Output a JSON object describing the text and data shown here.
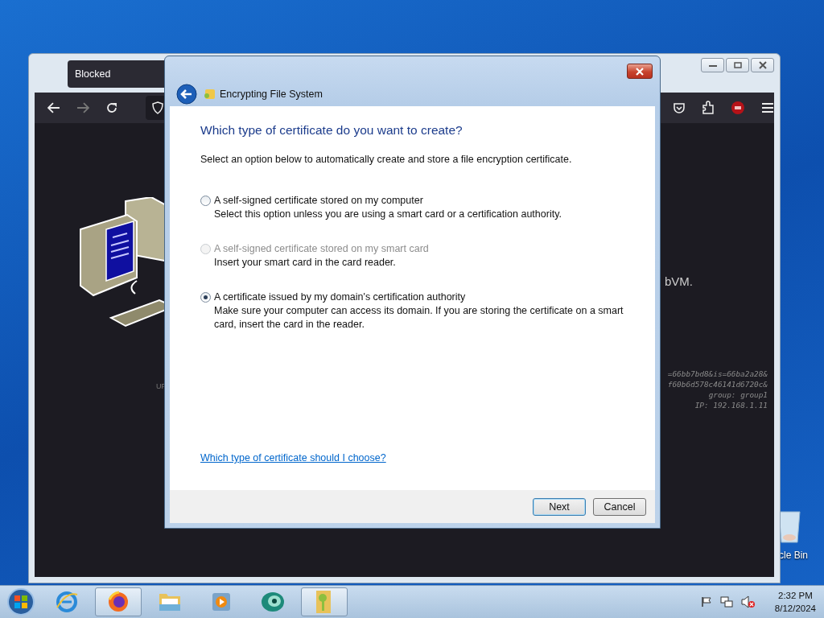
{
  "desktop": {
    "recycle_bin_label": "cle Bin"
  },
  "browser": {
    "tab": {
      "label": "Blocked",
      "selected": true
    },
    "page_fragment": "bVM.",
    "side_fragment": "UF",
    "details": [
      "=66bb7bd8&is=66ba2a28&",
      "f60b6d578c46141d6720c&",
      "group: group1",
      "IP: 192.168.1.11"
    ]
  },
  "dialog": {
    "title": "Encrypting File System",
    "heading": "Which type of certificate do you want to create?",
    "intro": "Select an option below to automatically create and store a file encryption certificate.",
    "options": [
      {
        "label": "A self-signed certificate stored on my computer",
        "description": "Select this option unless you are using a smart card or a certification authority.",
        "selected": false,
        "disabled": false
      },
      {
        "label": "A self-signed certificate stored on my smart card",
        "description": "Insert your smart card in the card reader.",
        "selected": false,
        "disabled": true
      },
      {
        "label": "A certificate issued by my domain's certification authority",
        "description": "Make sure your computer can access its domain. If you are storing the certificate on a smart card, insert the card in the reader.",
        "selected": true,
        "disabled": false
      }
    ],
    "help_link": "Which type of certificate should I choose?",
    "buttons": [
      {
        "label": "Next",
        "default": true
      },
      {
        "label": "Cancel",
        "default": false
      }
    ]
  },
  "taskbar": {
    "items": [
      {
        "kind": "ie",
        "selected": false
      },
      {
        "kind": "firefox",
        "selected": true
      },
      {
        "kind": "explorer",
        "selected": false
      },
      {
        "kind": "media",
        "selected": false
      },
      {
        "kind": "disc",
        "selected": false
      },
      {
        "kind": "efs",
        "selected": true
      }
    ],
    "time": "2:32 PM",
    "date": "8/12/2024"
  }
}
